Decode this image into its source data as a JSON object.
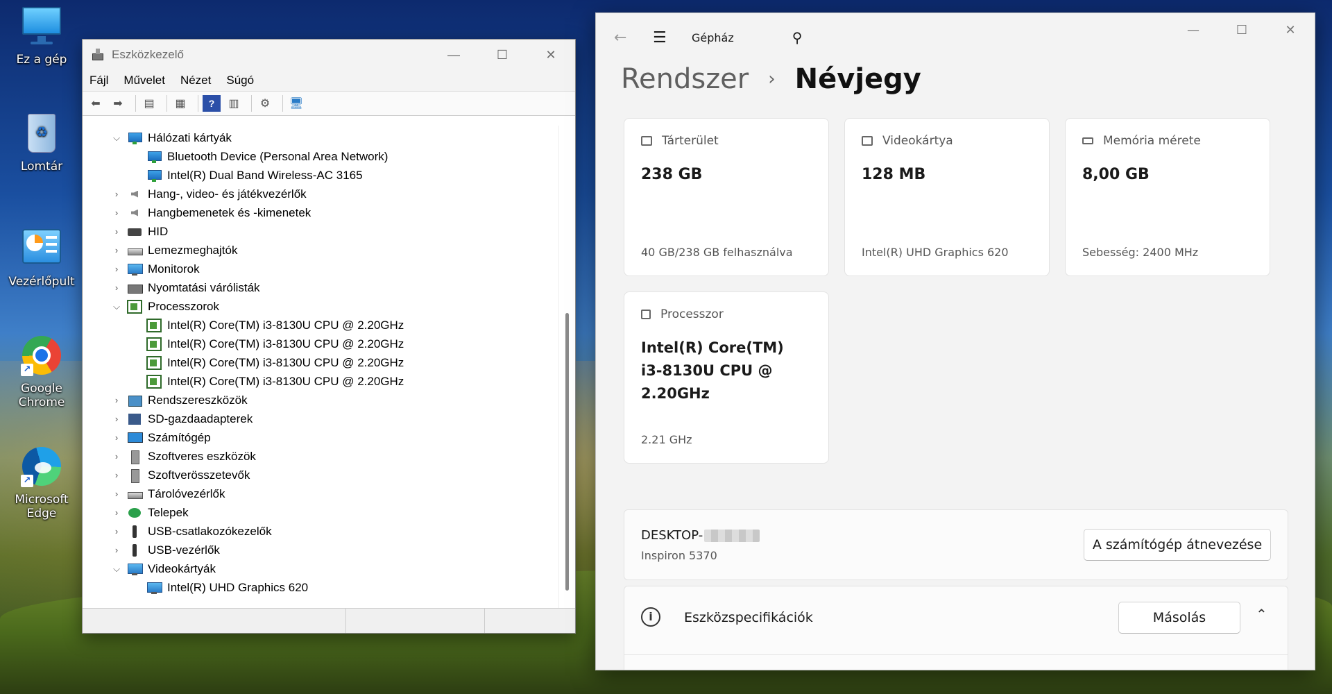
{
  "desktop": {
    "icons": [
      {
        "label": "Ez a gép"
      },
      {
        "label": "Lomtár"
      },
      {
        "label": "Vezérlőpult"
      },
      {
        "label": "Google Chrome"
      },
      {
        "label": "Microsoft Edge"
      }
    ]
  },
  "device_manager": {
    "title": "Eszközkezelő",
    "menu": [
      "Fájl",
      "Művelet",
      "Nézet",
      "Súgó"
    ],
    "tree": [
      {
        "label": "Hálózati kártyák",
        "expanded": true,
        "icon": "network-adapter-icon",
        "children": [
          {
            "label": "Bluetooth Device (Personal Area Network)",
            "icon": "network-adapter-icon"
          },
          {
            "label": "Intel(R) Dual Band Wireless-AC 3165",
            "icon": "network-adapter-icon"
          }
        ]
      },
      {
        "label": "Hang-, video- és játékvezérlők",
        "icon": "speaker-icon"
      },
      {
        "label": "Hangbemenetek és -kimenetek",
        "icon": "speaker-icon"
      },
      {
        "label": "HID",
        "icon": "keyboard-icon"
      },
      {
        "label": "Lemezmeghajtók",
        "icon": "disk-icon"
      },
      {
        "label": "Monitorok",
        "icon": "monitor-icon"
      },
      {
        "label": "Nyomtatási várólisták",
        "icon": "printer-icon"
      },
      {
        "label": "Processzorok",
        "expanded": true,
        "icon": "cpu-icon",
        "children": [
          {
            "label": "Intel(R) Core(TM) i3-8130U CPU @ 2.20GHz",
            "icon": "cpu-icon"
          },
          {
            "label": "Intel(R) Core(TM) i3-8130U CPU @ 2.20GHz",
            "icon": "cpu-icon"
          },
          {
            "label": "Intel(R) Core(TM) i3-8130U CPU @ 2.20GHz",
            "icon": "cpu-icon"
          },
          {
            "label": "Intel(R) Core(TM) i3-8130U CPU @ 2.20GHz",
            "icon": "cpu-icon"
          }
        ]
      },
      {
        "label": "Rendszereszközök",
        "icon": "folder-icon"
      },
      {
        "label": "SD-gazdaadapterek",
        "icon": "sd-card-icon"
      },
      {
        "label": "Számítógép",
        "icon": "computer-icon"
      },
      {
        "label": "Szoftveres eszközök",
        "icon": "software-device-icon"
      },
      {
        "label": "Szoftverösszetevők",
        "icon": "software-component-icon"
      },
      {
        "label": "Tárolóvezérlők",
        "icon": "storage-controller-icon"
      },
      {
        "label": "Telepek",
        "icon": "battery-icon"
      },
      {
        "label": "USB-csatlakozókezelők",
        "icon": "usb-icon"
      },
      {
        "label": "USB-vezérlők",
        "icon": "usb-icon"
      },
      {
        "label": "Videokártyák",
        "expanded": true,
        "icon": "display-adapter-icon",
        "children": [
          {
            "label": "Intel(R) UHD Graphics 620",
            "icon": "display-adapter-icon"
          }
        ]
      }
    ]
  },
  "settings": {
    "app_name": "Gépház",
    "breadcrumb": {
      "parent": "Rendszer",
      "current": "Névjegy"
    },
    "cards": {
      "storage": {
        "label": "Tárterület",
        "value": "238 GB",
        "sub": "40 GB/238 GB felhasználva"
      },
      "gpu": {
        "label": "Videokártya",
        "value": "128 MB",
        "sub": "Intel(R) UHD Graphics 620"
      },
      "memory": {
        "label": "Memória mérete",
        "value": "8,00 GB",
        "sub": "Sebesség: 2400 MHz"
      },
      "cpu": {
        "label": "Processzor",
        "value": "Intel(R) Core(TM) i3-8130U CPU @ 2.20GHz",
        "sub": "2.21 GHz"
      }
    },
    "device": {
      "name_prefix": "DESKTOP-",
      "model": "Inspiron 5370",
      "rename_button": "A számítógép átnevezése"
    },
    "specs": {
      "title": "Eszközspecifikációk",
      "copy_button": "Másolás"
    }
  }
}
